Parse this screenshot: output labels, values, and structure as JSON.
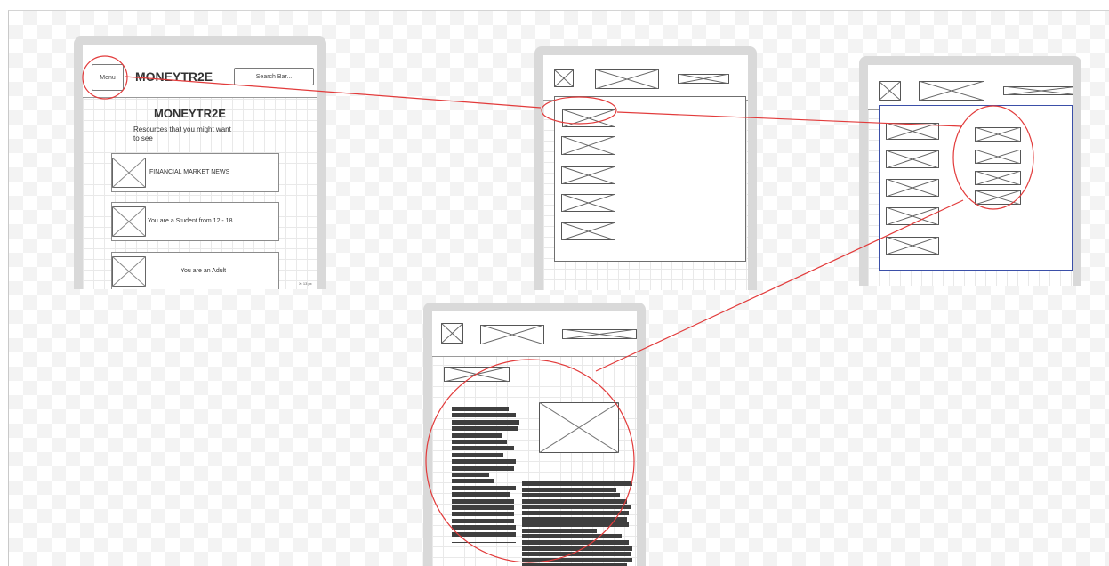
{
  "wireframe_1": {
    "menu_button": "Menu",
    "logo": "MONEYTR2E",
    "search_bar": "Search Bar...",
    "heading": "MONEYTR2E",
    "subheading_line1": "Resources that you might want",
    "subheading_line2": "to see",
    "cards": [
      {
        "label": "FINANCIAL MARKET NEWS"
      },
      {
        "label": "You are a Student from 12 - 18"
      },
      {
        "label": "You are an Adult"
      }
    ],
    "zoom_label": "X: 13 px"
  },
  "annotation_color": "#e23b3b",
  "selection_color": "#3b4fa8"
}
